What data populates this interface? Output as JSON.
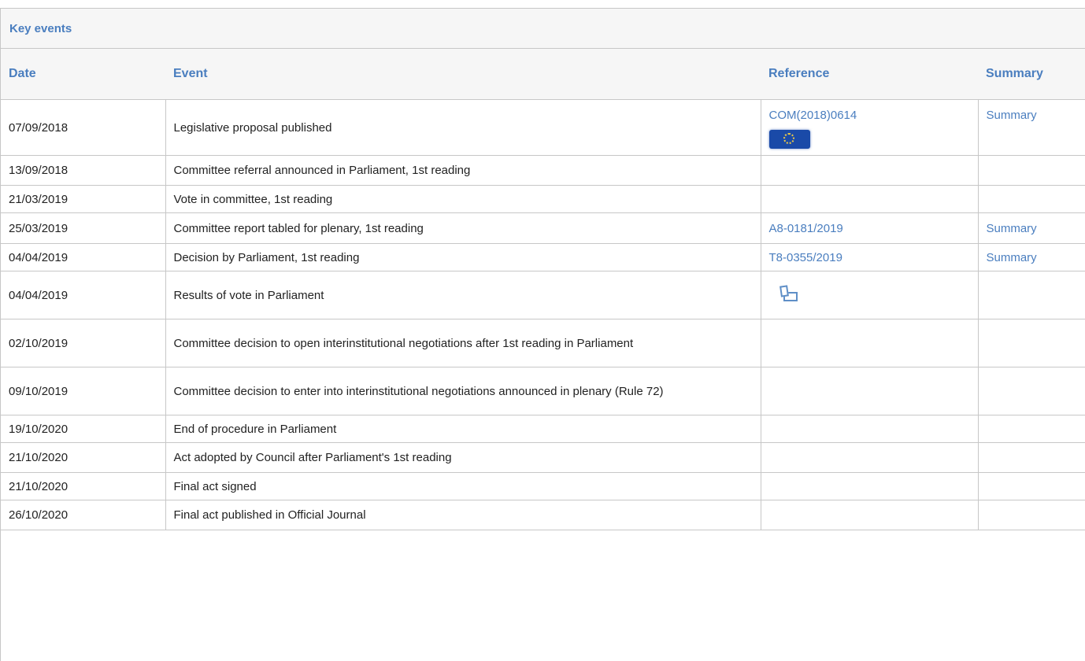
{
  "section": {
    "title": "Key events"
  },
  "columns": {
    "date": "Date",
    "event": "Event",
    "reference": "Reference",
    "summary": "Summary"
  },
  "rows": [
    {
      "date": "07/09/2018",
      "event": "Legislative proposal published",
      "reference": "COM(2018)0614",
      "reference_icon": "eu-flag-icon",
      "summary": "Summary"
    },
    {
      "date": "13/09/2018",
      "event": "Committee referral announced in Parliament, 1st reading",
      "reference": "",
      "summary": ""
    },
    {
      "date": "21/03/2019",
      "event": "Vote in committee, 1st reading",
      "reference": "",
      "summary": ""
    },
    {
      "date": "25/03/2019",
      "event": "Committee report tabled for plenary, 1st reading",
      "reference": "A8-0181/2019",
      "summary": "Summary"
    },
    {
      "date": "04/04/2019",
      "event": "Decision by Parliament, 1st reading",
      "reference": "T8-0355/2019",
      "summary": "Summary"
    },
    {
      "date": "04/04/2019",
      "event": "Results of vote in Parliament",
      "reference": "",
      "reference_icon": "vote-results-icon",
      "summary": ""
    },
    {
      "date": "02/10/2019",
      "event": "Committee decision to open interinstitutional negotiations after 1st reading in Parliament",
      "reference": "",
      "summary": ""
    },
    {
      "date": "09/10/2019",
      "event": "Committee decision to enter into interinstitutional negotiations announced in plenary (Rule 72)",
      "reference": "",
      "summary": ""
    },
    {
      "date": "19/10/2020",
      "event": "End of procedure in Parliament",
      "reference": "",
      "summary": ""
    },
    {
      "date": "21/10/2020",
      "event": "Act adopted by Council after Parliament's 1st reading",
      "reference": "",
      "summary": ""
    },
    {
      "date": "21/10/2020",
      "event": "Final act signed",
      "reference": "",
      "summary": ""
    },
    {
      "date": "26/10/2020",
      "event": "Final act published in Official Journal",
      "reference": "",
      "summary": ""
    }
  ],
  "colors": {
    "link": "#4a7ebf",
    "header_bg": "#f6f6f6",
    "border": "#c7c7c7"
  }
}
